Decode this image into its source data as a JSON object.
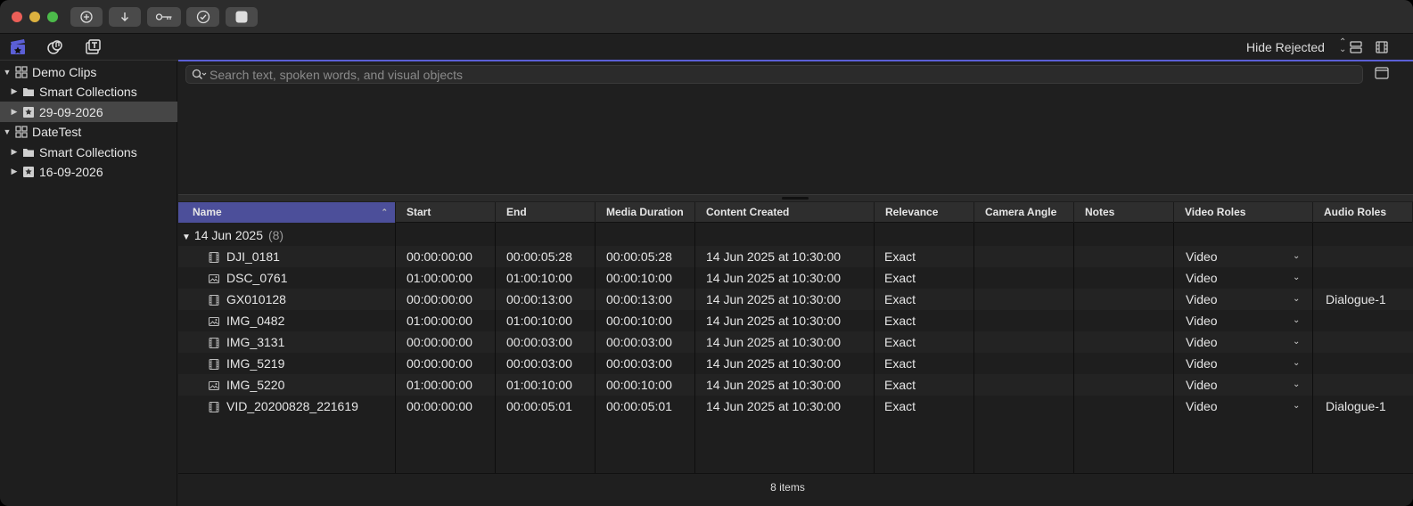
{
  "toolbar": {
    "buttons": [
      "add-icon",
      "import-icon",
      "keyword-icon",
      "checkmark-icon",
      "square-icon"
    ],
    "hide_rejected": "Hide Rejected",
    "accent": "#5b5fd6"
  },
  "sidebar": {
    "items": [
      {
        "label": "Demo Clips",
        "type": "library",
        "expanded": true
      },
      {
        "label": "Smart Collections",
        "type": "folder",
        "expanded": false
      },
      {
        "label": "29-09-2026",
        "type": "event",
        "expanded": false,
        "selected": true
      },
      {
        "label": "DateTest",
        "type": "library",
        "expanded": true
      },
      {
        "label": "Smart Collections",
        "type": "folder",
        "expanded": false
      },
      {
        "label": "16-09-2026",
        "type": "event",
        "expanded": false
      }
    ]
  },
  "search": {
    "placeholder": "Search text, spoken words, and visual objects"
  },
  "table": {
    "columns": [
      "Name",
      "Start",
      "End",
      "Media Duration",
      "Content Created",
      "Relevance",
      "Camera Angle",
      "Notes",
      "Video Roles",
      "Audio Roles"
    ],
    "group": {
      "label": "14 Jun 2025",
      "count": "(8)"
    },
    "rows": [
      {
        "name": "DJI_0181",
        "kind": "video",
        "start": "00:00:00:00",
        "end": "00:00:05:28",
        "duration": "00:00:05:28",
        "created": "14 Jun 2025 at 10:30:00",
        "relevance": "Exact",
        "camera_angle": "",
        "notes": "",
        "video_role": "Video",
        "audio_role": ""
      },
      {
        "name": "DSC_0761",
        "kind": "photo",
        "start": "01:00:00:00",
        "end": "01:00:10:00",
        "duration": "00:00:10:00",
        "created": "14 Jun 2025 at 10:30:00",
        "relevance": "Exact",
        "camera_angle": "",
        "notes": "",
        "video_role": "Video",
        "audio_role": ""
      },
      {
        "name": "GX010128",
        "kind": "video",
        "start": "00:00:00:00",
        "end": "00:00:13:00",
        "duration": "00:00:13:00",
        "created": "14 Jun 2025 at 10:30:00",
        "relevance": "Exact",
        "camera_angle": "",
        "notes": "",
        "video_role": "Video",
        "audio_role": "Dialogue-1"
      },
      {
        "name": "IMG_0482",
        "kind": "photo",
        "start": "01:00:00:00",
        "end": "01:00:10:00",
        "duration": "00:00:10:00",
        "created": "14 Jun 2025 at 10:30:00",
        "relevance": "Exact",
        "camera_angle": "",
        "notes": "",
        "video_role": "Video",
        "audio_role": ""
      },
      {
        "name": "IMG_3131",
        "kind": "video",
        "start": "00:00:00:00",
        "end": "00:00:03:00",
        "duration": "00:00:03:00",
        "created": "14 Jun 2025 at 10:30:00",
        "relevance": "Exact",
        "camera_angle": "",
        "notes": "",
        "video_role": "Video",
        "audio_role": ""
      },
      {
        "name": "IMG_5219",
        "kind": "video",
        "start": "00:00:00:00",
        "end": "00:00:03:00",
        "duration": "00:00:03:00",
        "created": "14 Jun 2025 at 10:30:00",
        "relevance": "Exact",
        "camera_angle": "",
        "notes": "",
        "video_role": "Video",
        "audio_role": ""
      },
      {
        "name": "IMG_5220",
        "kind": "photo",
        "start": "01:00:00:00",
        "end": "01:00:10:00",
        "duration": "00:00:10:00",
        "created": "14 Jun 2025 at 10:30:00",
        "relevance": "Exact",
        "camera_angle": "",
        "notes": "",
        "video_role": "Video",
        "audio_role": ""
      },
      {
        "name": "VID_20200828_221619",
        "kind": "video",
        "start": "00:00:00:00",
        "end": "00:00:05:01",
        "duration": "00:00:05:01",
        "created": "14 Jun 2025 at 10:30:00",
        "relevance": "Exact",
        "camera_angle": "",
        "notes": "",
        "video_role": "Video",
        "audio_role": "Dialogue-1"
      }
    ]
  },
  "footer": {
    "item_count": "8 items"
  }
}
